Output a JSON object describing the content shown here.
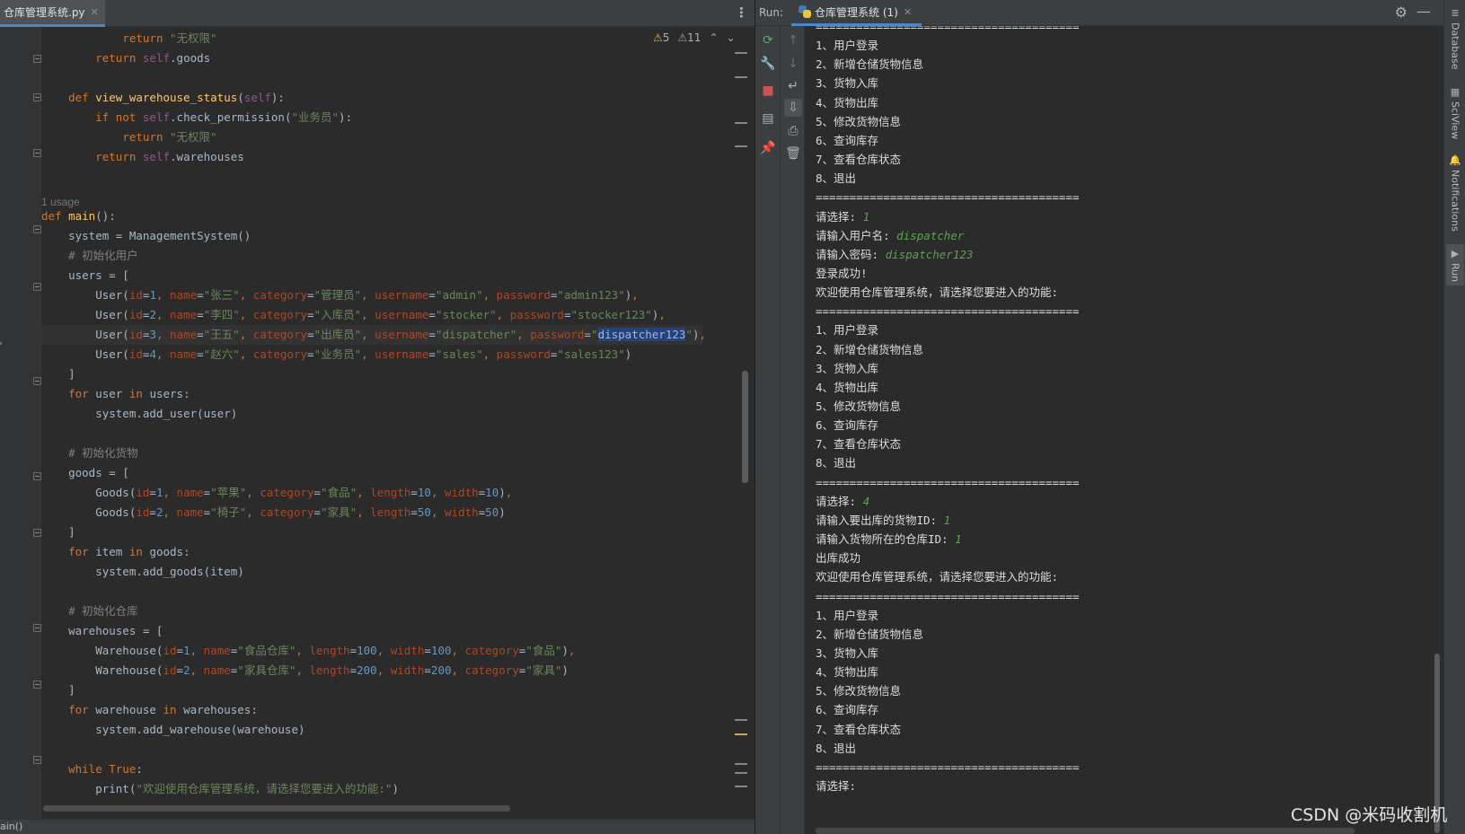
{
  "editor": {
    "file_tab": "仓库管理系统.py",
    "inspections": {
      "warnings": "5",
      "weak_warnings": "11"
    },
    "breadcrumb": "ain()",
    "usage_hint": "1 usage"
  },
  "code_lines": [
    [
      [
        "    ",
        ""
      ],
      [
        "        return ",
        "kw"
      ],
      [
        "\"无权限\"",
        "str"
      ]
    ],
    [
      [
        "        ",
        ""
      ],
      [
        "return ",
        "kw"
      ],
      [
        "self",
        "self"
      ],
      [
        ".goods",
        ""
      ]
    ],
    [],
    [
      [
        "    ",
        ""
      ],
      [
        "def ",
        "kw"
      ],
      [
        "view_warehouse_status",
        "fn"
      ],
      [
        "(",
        ""
      ],
      [
        "self",
        "self"
      ],
      [
        "):",
        ""
      ]
    ],
    [
      [
        "        ",
        ""
      ],
      [
        "if not ",
        "kw"
      ],
      [
        "self",
        "self"
      ],
      [
        ".check_permission(",
        ""
      ],
      [
        "\"业务员\"",
        "str"
      ],
      [
        "):",
        ""
      ]
    ],
    [
      [
        "            ",
        ""
      ],
      [
        "return ",
        "kw"
      ],
      [
        "\"无权限\"",
        "str"
      ]
    ],
    [
      [
        "        ",
        ""
      ],
      [
        "return ",
        "kw"
      ],
      [
        "self",
        "self"
      ],
      [
        ".warehouses",
        ""
      ]
    ],
    [],
    [],
    [
      [
        "def ",
        "kw"
      ],
      [
        "main",
        "fn"
      ],
      [
        "():",
        ""
      ]
    ],
    [
      [
        "    system = ManagementSystem()",
        ""
      ]
    ],
    [
      [
        "    ",
        ""
      ],
      [
        "# 初始化用户",
        "cmt"
      ]
    ],
    [
      [
        "    users = [",
        ""
      ]
    ],
    [
      [
        "        User(",
        ""
      ],
      [
        "id",
        "param"
      ],
      [
        "=",
        ""
      ],
      [
        "1",
        "num"
      ],
      [
        ", ",
        "kw"
      ],
      [
        "name",
        "param"
      ],
      [
        "=",
        ""
      ],
      [
        "\"张三\"",
        "str"
      ],
      [
        ", ",
        "kw"
      ],
      [
        "category",
        "param"
      ],
      [
        "=",
        ""
      ],
      [
        "\"管理员\"",
        "str"
      ],
      [
        ", ",
        "kw"
      ],
      [
        "username",
        "param"
      ],
      [
        "=",
        ""
      ],
      [
        "\"admin\"",
        "str"
      ],
      [
        ", ",
        "kw"
      ],
      [
        "password",
        "param"
      ],
      [
        "=",
        ""
      ],
      [
        "\"admin123\"",
        "str"
      ],
      [
        ")",
        ""
      ],
      [
        ",",
        "kw"
      ]
    ],
    [
      [
        "        User(",
        ""
      ],
      [
        "id",
        "param"
      ],
      [
        "=",
        ""
      ],
      [
        "2",
        "num"
      ],
      [
        ", ",
        "kw"
      ],
      [
        "name",
        "param"
      ],
      [
        "=",
        ""
      ],
      [
        "\"李四\"",
        "str"
      ],
      [
        ", ",
        "kw"
      ],
      [
        "category",
        "param"
      ],
      [
        "=",
        ""
      ],
      [
        "\"入库员\"",
        "str"
      ],
      [
        ", ",
        "kw"
      ],
      [
        "username",
        "param"
      ],
      [
        "=",
        ""
      ],
      [
        "\"stocker\"",
        "str"
      ],
      [
        ", ",
        "kw"
      ],
      [
        "password",
        "param"
      ],
      [
        "=",
        ""
      ],
      [
        "\"stocker123\"",
        "str"
      ],
      [
        ")",
        ""
      ],
      [
        ",",
        "kw"
      ]
    ],
    [
      [
        "        User(",
        ""
      ],
      [
        "id",
        "param"
      ],
      [
        "=",
        ""
      ],
      [
        "3",
        "num"
      ],
      [
        ", ",
        "kw"
      ],
      [
        "name",
        "param"
      ],
      [
        "=",
        ""
      ],
      [
        "\"王五\"",
        "str"
      ],
      [
        ", ",
        "kw"
      ],
      [
        "category",
        "param"
      ],
      [
        "=",
        ""
      ],
      [
        "\"出库员\"",
        "str"
      ],
      [
        ", ",
        "kw"
      ],
      [
        "username",
        "param"
      ],
      [
        "=",
        ""
      ],
      [
        "\"dispatcher\"",
        "str"
      ],
      [
        ", ",
        "kw"
      ],
      [
        "password",
        "param"
      ],
      [
        "=",
        ""
      ],
      [
        "\"",
        "str"
      ],
      [
        "dispatcher123",
        "sel"
      ],
      [
        "\"",
        "str"
      ],
      [
        ")",
        ""
      ],
      [
        ",",
        "kw"
      ]
    ],
    [
      [
        "        User(",
        ""
      ],
      [
        "id",
        "param"
      ],
      [
        "=",
        ""
      ],
      [
        "4",
        "num"
      ],
      [
        ", ",
        "kw"
      ],
      [
        "name",
        "param"
      ],
      [
        "=",
        ""
      ],
      [
        "\"赵六\"",
        "str"
      ],
      [
        ", ",
        "kw"
      ],
      [
        "category",
        "param"
      ],
      [
        "=",
        ""
      ],
      [
        "\"业务员\"",
        "str"
      ],
      [
        ", ",
        "kw"
      ],
      [
        "username",
        "param"
      ],
      [
        "=",
        ""
      ],
      [
        "\"sales\"",
        "str"
      ],
      [
        ", ",
        "kw"
      ],
      [
        "password",
        "param"
      ],
      [
        "=",
        ""
      ],
      [
        "\"sales123\"",
        "str"
      ],
      [
        ")",
        ""
      ]
    ],
    [
      [
        "    ]",
        ""
      ]
    ],
    [
      [
        "    ",
        ""
      ],
      [
        "for ",
        "kw"
      ],
      [
        "user ",
        ""
      ],
      [
        "in ",
        "kw"
      ],
      [
        "users:",
        ""
      ]
    ],
    [
      [
        "        system.add_user(user)",
        ""
      ]
    ],
    [],
    [
      [
        "    ",
        ""
      ],
      [
        "# 初始化货物",
        "cmt"
      ]
    ],
    [
      [
        "    goods = [",
        ""
      ]
    ],
    [
      [
        "        Goods(",
        ""
      ],
      [
        "id",
        "param"
      ],
      [
        "=",
        ""
      ],
      [
        "1",
        "num"
      ],
      [
        ", ",
        "kw"
      ],
      [
        "name",
        "param"
      ],
      [
        "=",
        ""
      ],
      [
        "\"苹果\"",
        "str"
      ],
      [
        ", ",
        "kw"
      ],
      [
        "category",
        "param"
      ],
      [
        "=",
        ""
      ],
      [
        "\"食品\"",
        "str"
      ],
      [
        ", ",
        "kw"
      ],
      [
        "length",
        "param"
      ],
      [
        "=",
        ""
      ],
      [
        "10",
        "num"
      ],
      [
        ", ",
        "kw"
      ],
      [
        "width",
        "param"
      ],
      [
        "=",
        ""
      ],
      [
        "10",
        "num"
      ],
      [
        ")",
        ""
      ],
      [
        ",",
        "kw"
      ]
    ],
    [
      [
        "        Goods(",
        ""
      ],
      [
        "id",
        "param"
      ],
      [
        "=",
        ""
      ],
      [
        "2",
        "num"
      ],
      [
        ", ",
        "kw"
      ],
      [
        "name",
        "param"
      ],
      [
        "=",
        ""
      ],
      [
        "\"椅子\"",
        "str"
      ],
      [
        ", ",
        "kw"
      ],
      [
        "category",
        "param"
      ],
      [
        "=",
        ""
      ],
      [
        "\"家具\"",
        "str"
      ],
      [
        ", ",
        "kw"
      ],
      [
        "length",
        "param"
      ],
      [
        "=",
        ""
      ],
      [
        "50",
        "num"
      ],
      [
        ", ",
        "kw"
      ],
      [
        "width",
        "param"
      ],
      [
        "=",
        ""
      ],
      [
        "50",
        "num"
      ],
      [
        ")",
        ""
      ]
    ],
    [
      [
        "    ]",
        ""
      ]
    ],
    [
      [
        "    ",
        ""
      ],
      [
        "for ",
        "kw"
      ],
      [
        "item ",
        ""
      ],
      [
        "in ",
        "kw"
      ],
      [
        "goods:",
        ""
      ]
    ],
    [
      [
        "        system.add_goods(item)",
        ""
      ]
    ],
    [],
    [
      [
        "    ",
        ""
      ],
      [
        "# 初始化仓库",
        "cmt"
      ]
    ],
    [
      [
        "    warehouses = [",
        ""
      ]
    ],
    [
      [
        "        Warehouse(",
        ""
      ],
      [
        "id",
        "param"
      ],
      [
        "=",
        ""
      ],
      [
        "1",
        "num"
      ],
      [
        ", ",
        "kw"
      ],
      [
        "name",
        "param"
      ],
      [
        "=",
        ""
      ],
      [
        "\"食品仓库\"",
        "str"
      ],
      [
        ", ",
        "kw"
      ],
      [
        "length",
        "param"
      ],
      [
        "=",
        ""
      ],
      [
        "100",
        "num"
      ],
      [
        ", ",
        "kw"
      ],
      [
        "width",
        "param"
      ],
      [
        "=",
        ""
      ],
      [
        "100",
        "num"
      ],
      [
        ", ",
        "kw"
      ],
      [
        "category",
        "param"
      ],
      [
        "=",
        ""
      ],
      [
        "\"食品\"",
        "str"
      ],
      [
        ")",
        ""
      ],
      [
        ",",
        "kw"
      ]
    ],
    [
      [
        "        Warehouse(",
        ""
      ],
      [
        "id",
        "param"
      ],
      [
        "=",
        ""
      ],
      [
        "2",
        "num"
      ],
      [
        ", ",
        "kw"
      ],
      [
        "name",
        "param"
      ],
      [
        "=",
        ""
      ],
      [
        "\"家具仓库\"",
        "str"
      ],
      [
        ", ",
        "kw"
      ],
      [
        "length",
        "param"
      ],
      [
        "=",
        ""
      ],
      [
        "200",
        "num"
      ],
      [
        ", ",
        "kw"
      ],
      [
        "width",
        "param"
      ],
      [
        "=",
        ""
      ],
      [
        "200",
        "num"
      ],
      [
        ", ",
        "kw"
      ],
      [
        "category",
        "param"
      ],
      [
        "=",
        ""
      ],
      [
        "\"家具\"",
        "str"
      ],
      [
        ")",
        ""
      ]
    ],
    [
      [
        "    ]",
        ""
      ]
    ],
    [
      [
        "    ",
        ""
      ],
      [
        "for ",
        "kw"
      ],
      [
        "warehouse ",
        ""
      ],
      [
        "in ",
        "kw"
      ],
      [
        "warehouses:",
        ""
      ]
    ],
    [
      [
        "        system.add_warehouse(warehouse)",
        ""
      ]
    ],
    [],
    [
      [
        "    ",
        ""
      ],
      [
        "while ",
        "kw"
      ],
      [
        "True",
        "kw"
      ],
      [
        ":",
        ""
      ]
    ],
    [
      [
        "        print(",
        ""
      ],
      [
        "\"欢迎使用仓库管理系统，请选择您要进入的功能:\"",
        "str"
      ],
      [
        ")",
        ""
      ]
    ]
  ],
  "run": {
    "label": "Run:",
    "tab": "仓库管理系统 (1)"
  },
  "console_lines": [
    [
      [
        "=======================================",
        ""
      ]
    ],
    [
      [
        "1、用户登录",
        ""
      ]
    ],
    [
      [
        "2、新增仓储货物信息",
        ""
      ]
    ],
    [
      [
        "3、货物入库",
        ""
      ]
    ],
    [
      [
        "4、货物出库",
        ""
      ]
    ],
    [
      [
        "5、修改货物信息",
        ""
      ]
    ],
    [
      [
        "6、查询库存",
        ""
      ]
    ],
    [
      [
        "7、查看仓库状态",
        ""
      ]
    ],
    [
      [
        "8、退出",
        ""
      ]
    ],
    [
      [
        "=======================================",
        ""
      ]
    ],
    [
      [
        "请选择: ",
        ""
      ],
      [
        "1",
        "input"
      ]
    ],
    [
      [
        "请输入用户名: ",
        ""
      ],
      [
        "dispatcher",
        "input"
      ]
    ],
    [
      [
        "请输入密码: ",
        ""
      ],
      [
        "dispatcher123",
        "input"
      ]
    ],
    [
      [
        "登录成功!",
        ""
      ]
    ],
    [
      [
        "欢迎使用仓库管理系统，请选择您要进入的功能:",
        ""
      ]
    ],
    [
      [
        "=======================================",
        ""
      ]
    ],
    [
      [
        "1、用户登录",
        ""
      ]
    ],
    [
      [
        "2、新增仓储货物信息",
        ""
      ]
    ],
    [
      [
        "3、货物入库",
        ""
      ]
    ],
    [
      [
        "4、货物出库",
        ""
      ]
    ],
    [
      [
        "5、修改货物信息",
        ""
      ]
    ],
    [
      [
        "6、查询库存",
        ""
      ]
    ],
    [
      [
        "7、查看仓库状态",
        ""
      ]
    ],
    [
      [
        "8、退出",
        ""
      ]
    ],
    [
      [
        "=======================================",
        ""
      ]
    ],
    [
      [
        "请选择: ",
        ""
      ],
      [
        "4",
        "input"
      ]
    ],
    [
      [
        "请输入要出库的货物ID: ",
        ""
      ],
      [
        "1",
        "input"
      ]
    ],
    [
      [
        "请输入货物所在的仓库ID: ",
        ""
      ],
      [
        "1",
        "input"
      ]
    ],
    [
      [
        "出库成功",
        ""
      ]
    ],
    [
      [
        "欢迎使用仓库管理系统，请选择您要进入的功能:",
        ""
      ]
    ],
    [
      [
        "=======================================",
        ""
      ]
    ],
    [
      [
        "1、用户登录",
        ""
      ]
    ],
    [
      [
        "2、新增仓储货物信息",
        ""
      ]
    ],
    [
      [
        "3、货物入库",
        ""
      ]
    ],
    [
      [
        "4、货物出库",
        ""
      ]
    ],
    [
      [
        "5、修改货物信息",
        ""
      ]
    ],
    [
      [
        "6、查询库存",
        ""
      ]
    ],
    [
      [
        "7、查看仓库状态",
        ""
      ]
    ],
    [
      [
        "8、退出",
        ""
      ]
    ],
    [
      [
        "=======================================",
        ""
      ]
    ],
    [
      [
        "请选择:",
        ""
      ]
    ]
  ],
  "right_strip": [
    "Database",
    "SciView",
    "Notifications",
    "Run"
  ],
  "watermark": "CSDN @米码收割机"
}
